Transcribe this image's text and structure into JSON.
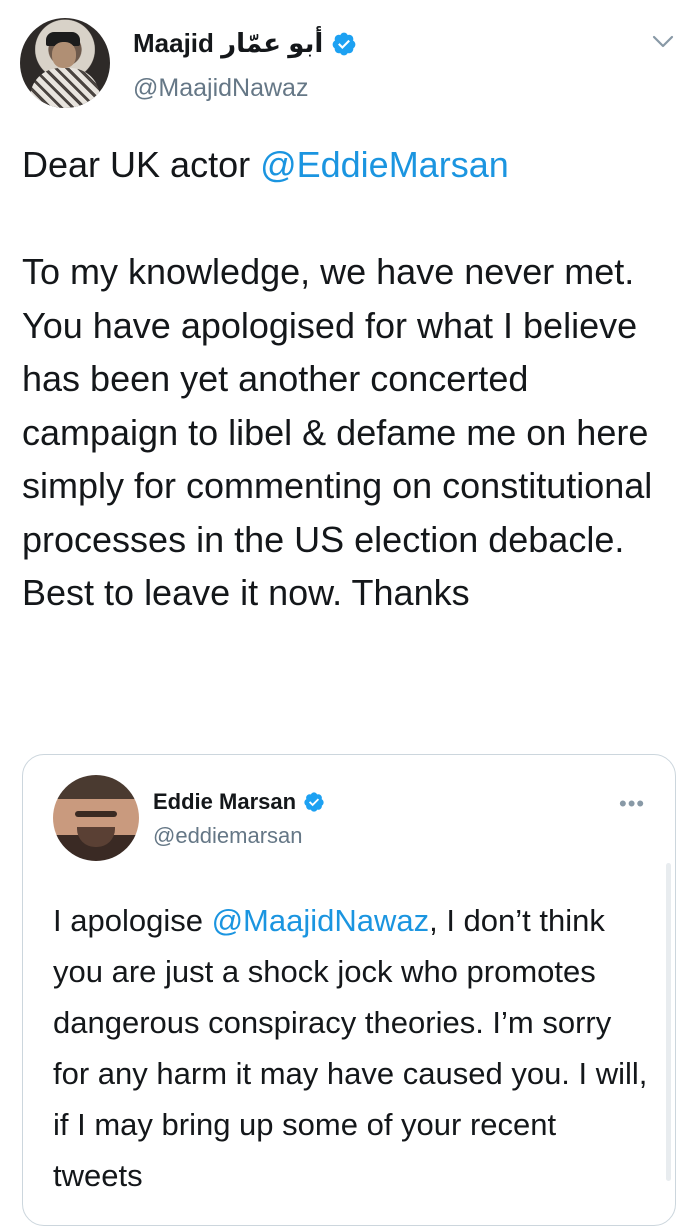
{
  "tweet": {
    "author_name": "Maajid أبو عمّار",
    "handle": "@MaajidNawaz",
    "text_intro": "Dear UK actor ",
    "text_mention": "@EddieMarsan",
    "text_body": "\n\nTo my knowledge, we have never met. You have apologised for what I believe has been yet another concerted campaign to libel & defame me on here simply for commenting on constitutional processes in the US election debacle. Best to leave it now. Thanks",
    "icons": {
      "verified": "verified-icon",
      "menu": "chevron-down-icon"
    }
  },
  "quoted": {
    "author_name": "Eddie Marsan",
    "handle": "@eddiemarsan",
    "more": "•••",
    "text_intro": "I apologise ",
    "text_mention": "@MaajidNawaz",
    "text_body": ", I don’t think you are just a shock jock who promotes dangerous conspiracy theories. I’m sorry for any harm it may have caused you. I will, if I may bring up some of your recent tweets",
    "icons": {
      "verified": "verified-icon",
      "more": "more-icon"
    }
  },
  "colors": {
    "link": "#1b95e0",
    "verified": "#1da1f2",
    "secondary": "#657786",
    "border": "#ccd6dd"
  }
}
